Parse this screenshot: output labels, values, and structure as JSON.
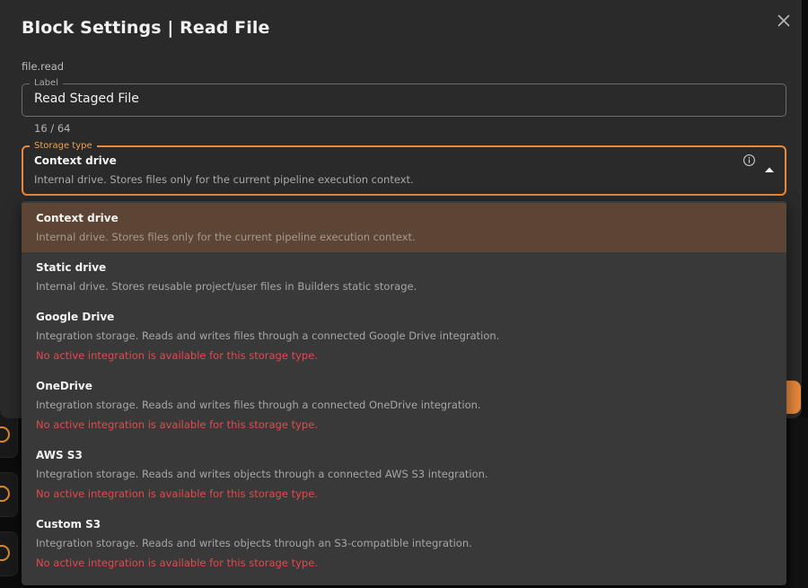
{
  "dialog": {
    "title": "Block Settings | Read File",
    "block_id": "file.read"
  },
  "label_field": {
    "legend": "Label",
    "value": "Read Staged File",
    "char_count": "16 / 64"
  },
  "storage_select": {
    "legend": "Storage type",
    "selected_title": "Context drive",
    "selected_desc": "Internal drive. Stores files only for the current pipeline execution context."
  },
  "dropdown": {
    "options": [
      {
        "title": "Context drive",
        "desc": "Internal drive. Stores files only for the current pipeline execution context.",
        "warning": ""
      },
      {
        "title": "Static drive",
        "desc": "Internal drive. Stores reusable project/user files in Builders static storage.",
        "warning": ""
      },
      {
        "title": "Google Drive",
        "desc": "Integration storage. Reads and writes files through a connected Google Drive integration.",
        "warning": "No active integration is available for this storage type."
      },
      {
        "title": "OneDrive",
        "desc": "Integration storage. Reads and writes files through a connected OneDrive integration.",
        "warning": "No active integration is available for this storage type."
      },
      {
        "title": "AWS S3",
        "desc": "Integration storage. Reads and writes objects through a connected AWS S3 integration.",
        "warning": "No active integration is available for this storage type."
      },
      {
        "title": "Custom S3",
        "desc": "Integration storage. Reads and writes objects through an S3-compatible integration.",
        "warning": "No active integration is available for this storage type."
      }
    ]
  },
  "icons": {
    "close": "close-icon",
    "info": "info-icon",
    "caret": "caret-up-icon"
  },
  "colors": {
    "accent": "#e8893d",
    "selected_option_bg": "#5c4534",
    "warning": "#e5484d",
    "dialog_bg": "#2a2a2a",
    "dropdown_bg": "#393939"
  }
}
